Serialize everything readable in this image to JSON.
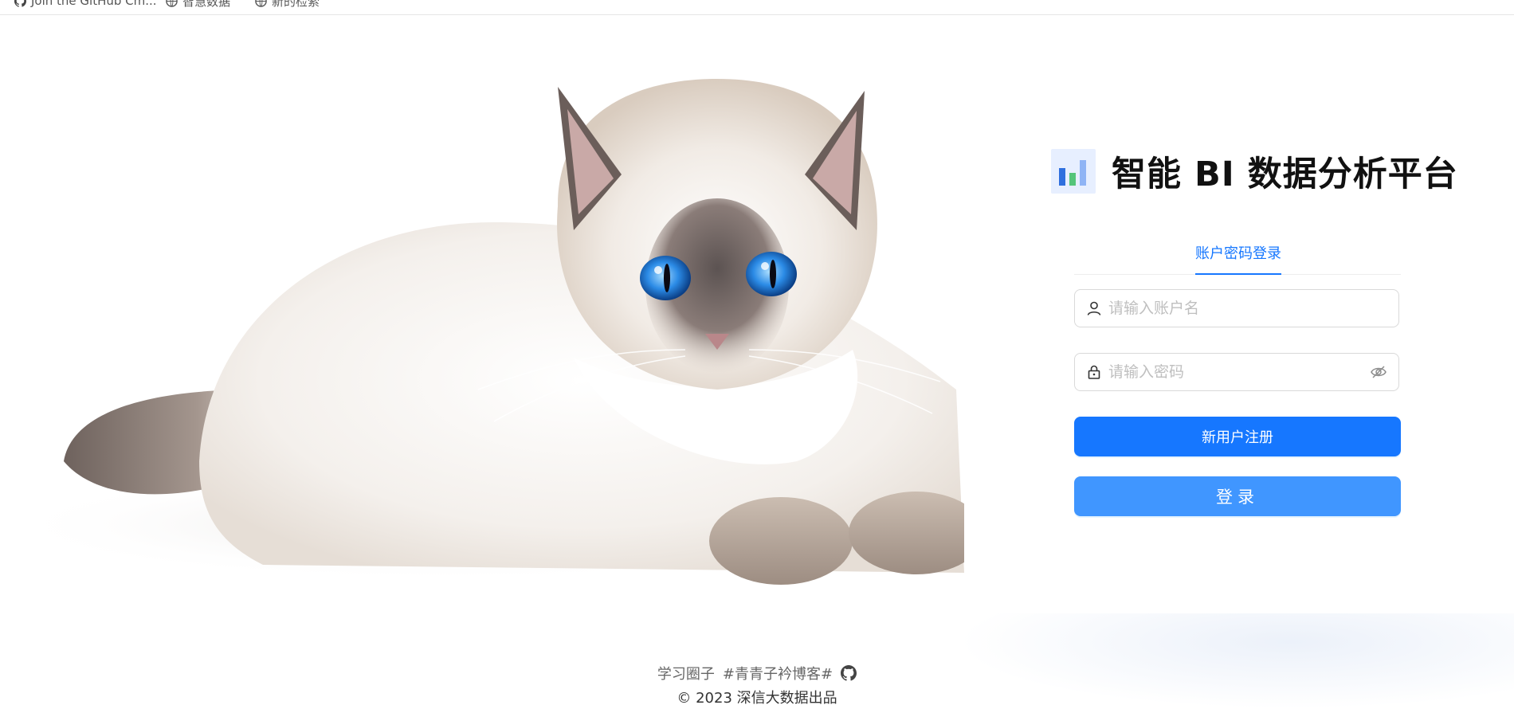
{
  "topbar": {
    "items": [
      {
        "label": "Join the GitHub Cm...",
        "icon": "github-icon"
      },
      {
        "label": "智慧数据",
        "icon": "globe-icon"
      },
      {
        "label": "新的检索",
        "icon": "globe-icon"
      }
    ]
  },
  "brand": {
    "title": "智能 BI 数据分析平台",
    "logo_icon": "bar-chart-icon",
    "logo_colors": [
      "#2f6fde",
      "#54c57a",
      "#8fb4f5"
    ]
  },
  "login": {
    "tab_label": "账户密码登录",
    "username_placeholder": "请输入账户名",
    "password_placeholder": "请输入密码",
    "register_label": "新用户注册",
    "login_label": "登录"
  },
  "footer": {
    "link1": "学习圈子",
    "link2": "#青青子衿博客#",
    "github_icon": "github-icon",
    "copyright_symbol": "©",
    "copyright_text": "2023 深信大数据出品"
  },
  "colors": {
    "primary": "#1677ff",
    "primary_light": "#4096ff",
    "placeholder": "#bfbfbf"
  }
}
